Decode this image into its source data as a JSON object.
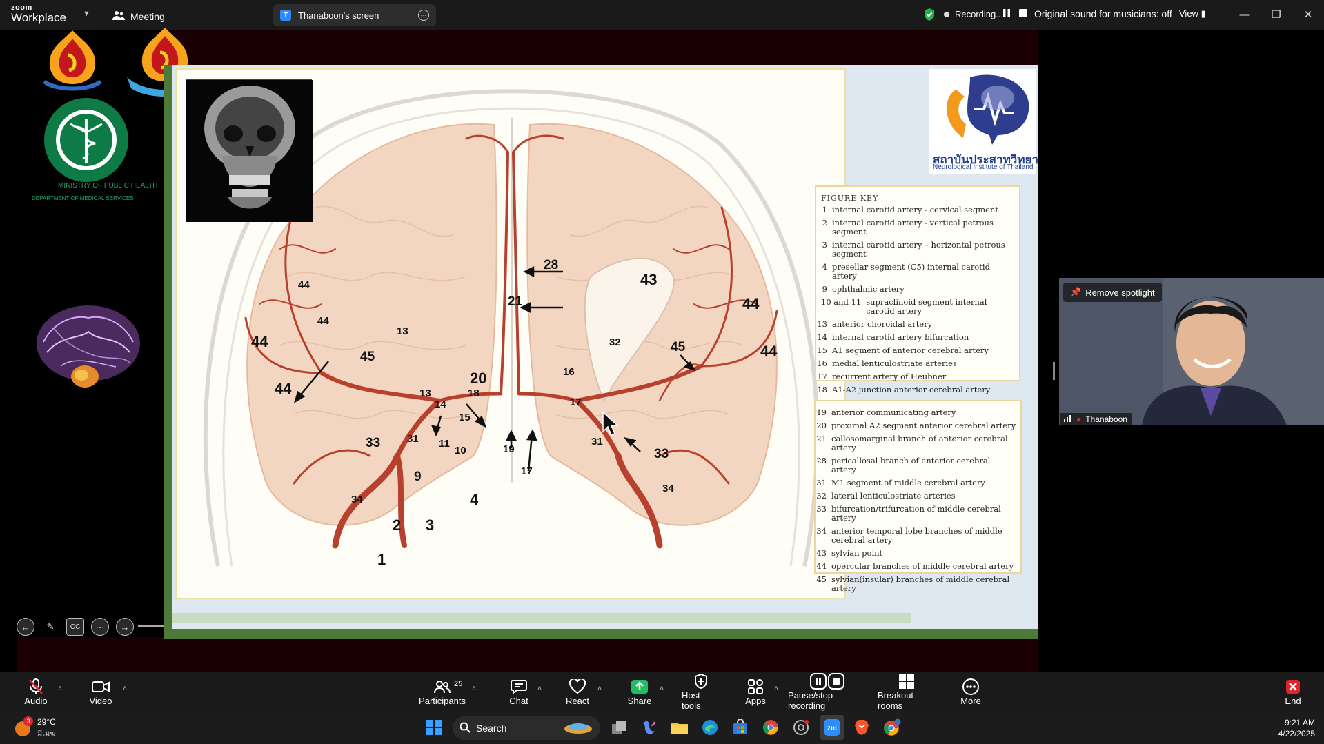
{
  "app": {
    "brand_top": "zoom",
    "brand_bottom": "Workplace",
    "meeting_label": "Meeting"
  },
  "screen_tab": {
    "initial": "T",
    "label": "Thanaboon's screen"
  },
  "recording": {
    "status": "Recording...",
    "original_sound": "Original sound for musicians: off",
    "view_label": "View"
  },
  "slide": {
    "ministry_en": "MINISTRY OF PUBLIC HEALTH",
    "dept_en": "DEPARTMENT OF MEDICAL SERVICES",
    "neuro_logo_th": "สถาบันประสาทวิทยา",
    "neuro_logo_en": "Neurological Institute of Thailand",
    "figure_key_title": "FIGURE KEY",
    "key_left": [
      {
        "n": "1",
        "t": "internal carotid artery - cervical segment"
      },
      {
        "n": "2",
        "t": "internal carotid artery - vertical petrous segment"
      },
      {
        "n": "3",
        "t": "internal carotid artery – horizontal petrous segment"
      },
      {
        "n": "4",
        "t": "presellar segment (C5) internal carotid artery"
      },
      {
        "n": "9",
        "t": "ophthalmic artery"
      },
      {
        "n": "10 and 11",
        "t": "supraclinoid segment internal carotid artery"
      },
      {
        "n": "13",
        "t": "anterior choroidal artery"
      },
      {
        "n": "14",
        "t": "internal carotid artery bifurcation"
      },
      {
        "n": "15",
        "t": "A1 segment of anterior cerebral artery"
      },
      {
        "n": "16",
        "t": "medial lenticulostriate arteries"
      },
      {
        "n": "17",
        "t": "recurrent artery of Heubner"
      },
      {
        "n": "18",
        "t": "A1-A2 junction anterior cerebral artery"
      }
    ],
    "key_right": [
      {
        "n": "19",
        "t": "anterior communicating artery"
      },
      {
        "n": "20",
        "t": "proximal A2 segment anterior cerebral artery"
      },
      {
        "n": "21",
        "t": "callosomarginal branch of anterior cerebral artery"
      },
      {
        "n": "28",
        "t": "pericallosal branch of anterior cerebral artery"
      },
      {
        "n": "31",
        "t": "M1 segment of middle cerebral artery"
      },
      {
        "n": "32",
        "t": "lateral lenticulostriate arteries"
      },
      {
        "n": "33",
        "t": "bifurcation/trifurcation of middle cerebral artery"
      },
      {
        "n": "34",
        "t": "anterior temporal lobe branches of middle cerebral artery"
      },
      {
        "n": "43",
        "t": "sylvian point"
      },
      {
        "n": "44",
        "t": "opercular branches of middle cerebral artery"
      },
      {
        "n": "45",
        "t": "sylvian(insular) branches of middle cerebral artery"
      }
    ],
    "diagram_labels": [
      {
        "t": "28"
      },
      {
        "t": "21"
      },
      {
        "t": "43"
      },
      {
        "t": "44"
      },
      {
        "t": "44"
      },
      {
        "t": "44"
      },
      {
        "t": "44"
      },
      {
        "t": "44"
      },
      {
        "t": "44"
      },
      {
        "t": "13"
      },
      {
        "t": "45"
      },
      {
        "t": "32"
      },
      {
        "t": "45"
      },
      {
        "t": "16"
      },
      {
        "t": "20"
      },
      {
        "t": "18"
      },
      {
        "t": "13"
      },
      {
        "t": "14"
      },
      {
        "t": "15"
      },
      {
        "t": "17"
      },
      {
        "t": "33"
      },
      {
        "t": "31"
      },
      {
        "t": "11"
      },
      {
        "t": "10"
      },
      {
        "t": "19"
      },
      {
        "t": "31"
      },
      {
        "t": "33"
      },
      {
        "t": "9"
      },
      {
        "t": "17"
      },
      {
        "t": "4"
      },
      {
        "t": "34"
      },
      {
        "t": "34"
      },
      {
        "t": "2"
      },
      {
        "t": "3"
      },
      {
        "t": "1"
      }
    ]
  },
  "video": {
    "spotlight_label": "Remove spotlight",
    "participant_name": "Thanaboon"
  },
  "toolbar": {
    "audio": "Audio",
    "video": "Video",
    "participants": "Participants",
    "participants_count": "25",
    "chat": "Chat",
    "react": "React",
    "share": "Share",
    "host_tools": "Host tools",
    "apps": "Apps",
    "pause_stop": "Pause/stop recording",
    "breakout": "Breakout rooms",
    "more": "More",
    "end": "End"
  },
  "taskbar": {
    "weather_temp": "29°C",
    "weather_status": "มีเมฆ",
    "weather_badge": "3",
    "search_placeholder": "Search",
    "time": "9:21 AM",
    "date": "4/22/2025"
  },
  "colors": {
    "share_accent": "#1fbf5f",
    "end_red": "#e0242b",
    "slide_green": "#4d7a38",
    "artery_red": "#b8412e"
  }
}
